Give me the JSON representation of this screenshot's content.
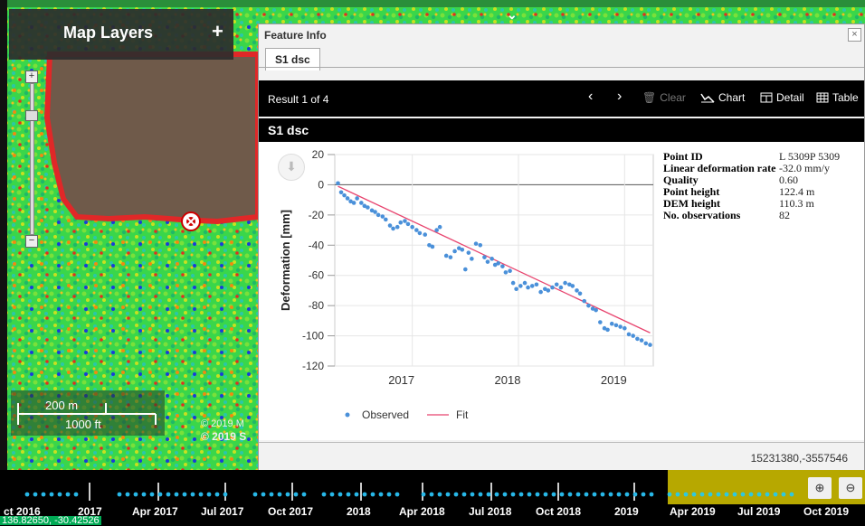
{
  "map": {
    "layers_title": "Map Layers",
    "add_layer_glyph": "+",
    "zoom_in_glyph": "+",
    "zoom_out_glyph": "−",
    "scale_metric": "200 m",
    "scale_imperial": "1000 ft",
    "attribution_line1": "© 2019 M",
    "attribution_line2": "© 2019 S",
    "coordinates": "136.82650, -30.42526"
  },
  "panel": {
    "title": "Feature Info",
    "close_glyph": "×",
    "tab_label": "S1 dsc",
    "result_text": "Result 1 of 4",
    "buttons": {
      "prev": "‹",
      "next": "›",
      "clear": "Clear",
      "chart": "Chart",
      "detail": "Detail",
      "table": "Table"
    },
    "section_title": "S1 dsc",
    "download_glyph": "⬇",
    "projected_coords": "15231380,-3557546",
    "info": [
      {
        "label": "Point ID",
        "value": "L 5309P 5309"
      },
      {
        "label": "Linear deformation rate",
        "value": "-32.0 mm/y"
      },
      {
        "label": "Quality",
        "value": "0.60"
      },
      {
        "label": "Point height",
        "value": "122.4 m"
      },
      {
        "label": "DEM height",
        "value": "110.3 m"
      },
      {
        "label": "No. observations",
        "value": "82"
      }
    ]
  },
  "chart_data": {
    "type": "scatter",
    "ylabel": "Deformation [mm]",
    "xlabel": "",
    "ylim": [
      -120,
      20
    ],
    "yticks": [
      20,
      0,
      -20,
      -40,
      -60,
      -80,
      -100,
      -120
    ],
    "xlim": [
      2016.27,
      2019.27
    ],
    "xticks": [
      {
        "value": 2017,
        "label": "2017"
      },
      {
        "value": 2018,
        "label": "2018"
      },
      {
        "value": 2019,
        "label": "2019"
      }
    ],
    "grid": true,
    "legend_position": "bottom",
    "series": [
      {
        "name": "Observed",
        "kind": "points",
        "color": "#4a90d9",
        "points": [
          [
            2016.3,
            1
          ],
          [
            2016.33,
            -5
          ],
          [
            2016.36,
            -7
          ],
          [
            2016.39,
            -9
          ],
          [
            2016.42,
            -11
          ],
          [
            2016.45,
            -12
          ],
          [
            2016.48,
            -9
          ],
          [
            2016.52,
            -12
          ],
          [
            2016.55,
            -14
          ],
          [
            2016.58,
            -15
          ],
          [
            2016.62,
            -17
          ],
          [
            2016.65,
            -18
          ],
          [
            2016.68,
            -20
          ],
          [
            2016.72,
            -21
          ],
          [
            2016.75,
            -23
          ],
          [
            2016.79,
            -27
          ],
          [
            2016.82,
            -29
          ],
          [
            2016.86,
            -28
          ],
          [
            2016.89,
            -25
          ],
          [
            2016.93,
            -24
          ],
          [
            2016.96,
            -26
          ],
          [
            2017.0,
            -28
          ],
          [
            2017.04,
            -30
          ],
          [
            2017.07,
            -32
          ],
          [
            2017.12,
            -33
          ],
          [
            2017.16,
            -40
          ],
          [
            2017.19,
            -41
          ],
          [
            2017.23,
            -30
          ],
          [
            2017.26,
            -28
          ],
          [
            2017.32,
            -47
          ],
          [
            2017.36,
            -48
          ],
          [
            2017.4,
            -44
          ],
          [
            2017.44,
            -42
          ],
          [
            2017.47,
            -43
          ],
          [
            2017.5,
            -56
          ],
          [
            2017.53,
            -45
          ],
          [
            2017.56,
            -49
          ],
          [
            2017.6,
            -39
          ],
          [
            2017.64,
            -40
          ],
          [
            2017.68,
            -48
          ],
          [
            2017.71,
            -51
          ],
          [
            2017.75,
            -49
          ],
          [
            2017.78,
            -53
          ],
          [
            2017.81,
            -52
          ],
          [
            2017.85,
            -54
          ],
          [
            2017.88,
            -58
          ],
          [
            2017.92,
            -57
          ],
          [
            2017.95,
            -65
          ],
          [
            2017.98,
            -69
          ],
          [
            2018.02,
            -67
          ],
          [
            2018.06,
            -65
          ],
          [
            2018.09,
            -68
          ],
          [
            2018.13,
            -67
          ],
          [
            2018.17,
            -66
          ],
          [
            2018.21,
            -71
          ],
          [
            2018.25,
            -69
          ],
          [
            2018.28,
            -70
          ],
          [
            2018.32,
            -68
          ],
          [
            2018.36,
            -66
          ],
          [
            2018.4,
            -68
          ],
          [
            2018.44,
            -65
          ],
          [
            2018.48,
            -66
          ],
          [
            2018.51,
            -67
          ],
          [
            2018.55,
            -70
          ],
          [
            2018.58,
            -72
          ],
          [
            2018.62,
            -77
          ],
          [
            2018.66,
            -80
          ],
          [
            2018.7,
            -82
          ],
          [
            2018.73,
            -83
          ],
          [
            2018.77,
            -91
          ],
          [
            2018.81,
            -95
          ],
          [
            2018.84,
            -96
          ],
          [
            2018.88,
            -92
          ],
          [
            2018.92,
            -93
          ],
          [
            2018.96,
            -94
          ],
          [
            2019.0,
            -95
          ],
          [
            2019.04,
            -99
          ],
          [
            2019.08,
            -100
          ],
          [
            2019.12,
            -102
          ],
          [
            2019.16,
            -103
          ],
          [
            2019.2,
            -105
          ],
          [
            2019.24,
            -106
          ]
        ]
      },
      {
        "name": "Fit",
        "kind": "line",
        "color": "#e8456f",
        "points": [
          [
            2016.3,
            -1
          ],
          [
            2019.24,
            -98
          ]
        ]
      }
    ]
  },
  "timeline": {
    "labels": [
      {
        "text": "ct 2016",
        "x": 0
      },
      {
        "text": "2017",
        "x": 0
      },
      {
        "text": "Apr 2017",
        "x": 0
      },
      {
        "text": "Jul 2017",
        "x": 0
      },
      {
        "text": "Oct 2017",
        "x": 0
      },
      {
        "text": "2018",
        "x": 0
      },
      {
        "text": "Apr 2018",
        "x": 0
      },
      {
        "text": "Jul 2018",
        "x": 0
      },
      {
        "text": "Oct 2018",
        "x": 0
      },
      {
        "text": "2019",
        "x": 0
      },
      {
        "text": "Apr 2019",
        "x": 0
      },
      {
        "text": "Jul 2019",
        "x": 0
      },
      {
        "text": "Oct 2019",
        "x": 0
      }
    ],
    "zoom_in_glyph": "⊕",
    "zoom_out_glyph": "⊖"
  }
}
